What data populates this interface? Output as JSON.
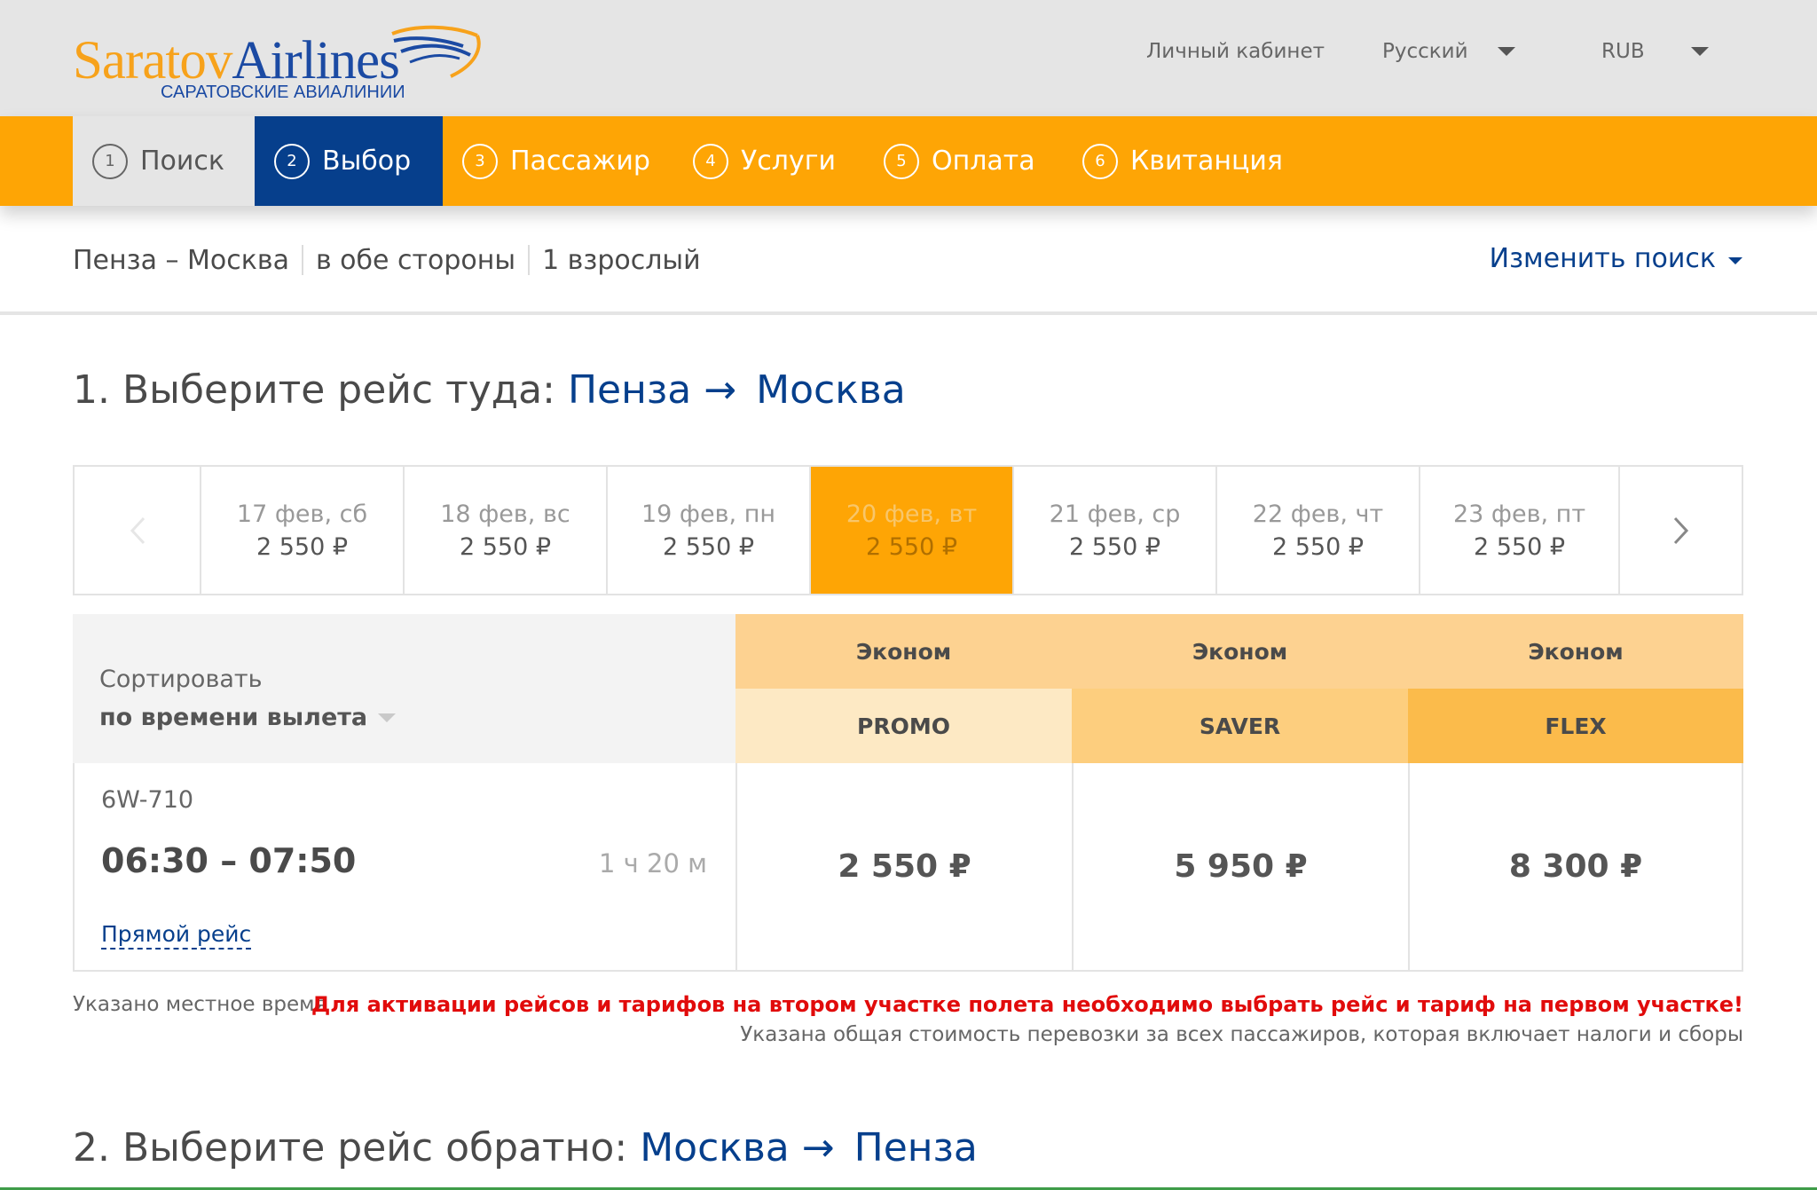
{
  "header": {
    "logo": {
      "name_part1": "Saratov",
      "name_part2": "Airlines",
      "subtitle": "САРАТОВСКИЕ АВИАЛИНИИ"
    },
    "account_label": "Личный кабинет",
    "language": "Русский",
    "currency": "RUB"
  },
  "steps": [
    {
      "number": "1",
      "label": "Поиск",
      "state": "done"
    },
    {
      "number": "2",
      "label": "Выбор",
      "state": "current"
    },
    {
      "number": "3",
      "label": "Пассажир",
      "state": "upcoming"
    },
    {
      "number": "4",
      "label": "Услуги",
      "state": "upcoming"
    },
    {
      "number": "5",
      "label": "Оплата",
      "state": "upcoming"
    },
    {
      "number": "6",
      "label": "Квитанция",
      "state": "upcoming"
    }
  ],
  "search_summary": {
    "route": "Пенза – Москва",
    "trip_type": "в обе стороны",
    "passengers": "1 взрослый",
    "change_search": "Изменить поиск"
  },
  "outbound": {
    "title_prefix": "1. Выберите рейс туда:",
    "from": "Пенза",
    "arrow": "→",
    "to": "Москва",
    "dates": [
      {
        "date": "17 фев, сб",
        "price": "2 550 ₽",
        "selected": false
      },
      {
        "date": "18 фев, вс",
        "price": "2 550 ₽",
        "selected": false
      },
      {
        "date": "19 фев, пн",
        "price": "2 550 ₽",
        "selected": false
      },
      {
        "date": "20 фев, вт",
        "price": "2 550 ₽",
        "selected": true
      },
      {
        "date": "21 фев, ср",
        "price": "2 550 ₽",
        "selected": false
      },
      {
        "date": "22 фев, чт",
        "price": "2 550 ₽",
        "selected": false
      },
      {
        "date": "23 фев, пт",
        "price": "2 550 ₽",
        "selected": false
      }
    ],
    "sort_label": "Сортировать",
    "sort_value": "по времени вылета",
    "fares": [
      {
        "class": "Эконом",
        "name": "PROMO",
        "color": "#fde9c4"
      },
      {
        "class": "Эконом",
        "name": "SAVER",
        "color": "#fdce7e"
      },
      {
        "class": "Эконом",
        "name": "FLEX",
        "color": "#fbbb4b"
      }
    ],
    "flight": {
      "number": "6W-710",
      "time": "06:30 – 07:50",
      "duration": "1 ч 20 м",
      "type": "Прямой рейс",
      "prices": [
        "2 550 ₽",
        "5 950 ₽",
        "8 300 ₽"
      ]
    },
    "note_local_time": "Указано местное время",
    "warning": "Для активации рейсов и тарифов на втором участке полета необходимо выбрать рейс и тариф на первом участке!",
    "note_total_price": "Указана общая стоимость перевозки за всех пассажиров, которая включает налоги и сборы"
  },
  "return": {
    "title_prefix": "2. Выберите рейс обратно:",
    "from": "Москва",
    "arrow": "→",
    "to": "Пенза"
  },
  "colors": {
    "brand_orange": "#fea505",
    "brand_blue": "#063f8c",
    "header_gray": "#e5e5e5",
    "warning_red": "#e10b0b"
  },
  "icons": {
    "prev_dates": "chevron-left-icon",
    "next_dates": "chevron-right-icon",
    "dropdown": "caret-down-icon"
  }
}
